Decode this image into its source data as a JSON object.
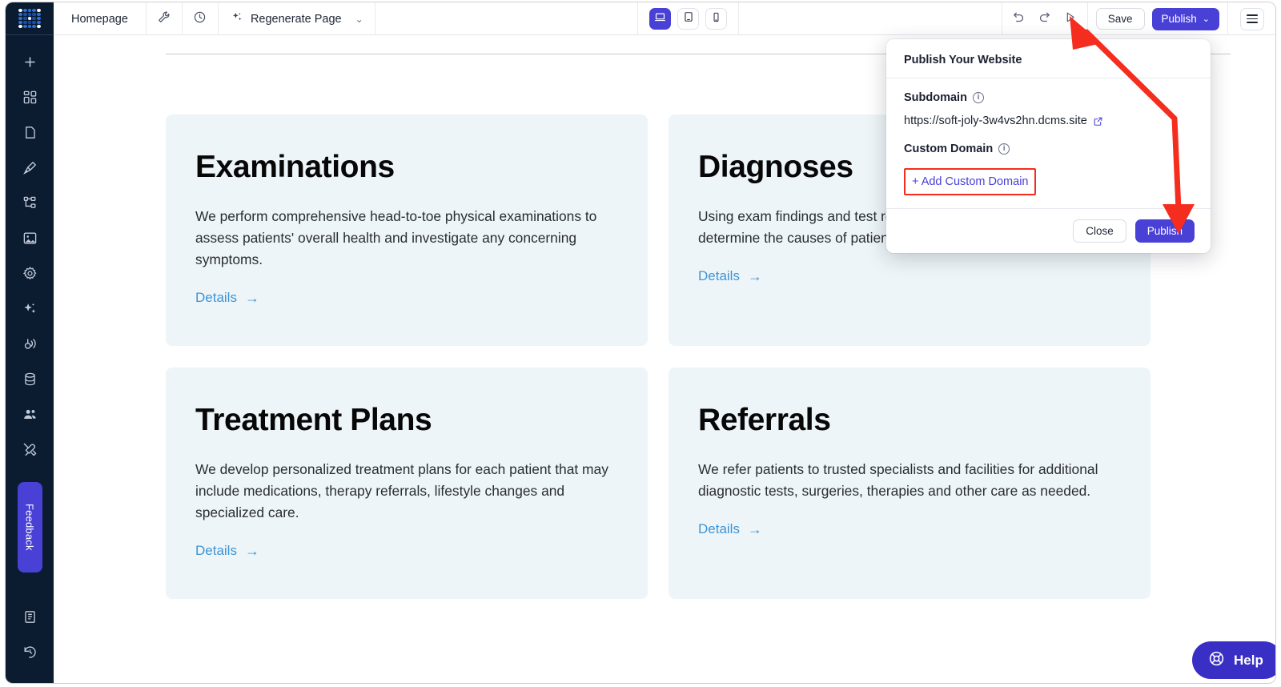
{
  "app": {
    "logo_icon": "dot-grid-logo-icon"
  },
  "toolbar": {
    "page_name": "Homepage",
    "wrench_icon": "wrench-icon",
    "history_icon": "clock-history-icon",
    "regenerate_label": "Regenerate Page",
    "regenerate_sparkle_icon": "sparkles-icon",
    "chevron": "⌄",
    "devices": [
      {
        "name": "desktop",
        "icon": "desktop-icon",
        "active": true
      },
      {
        "name": "tablet",
        "icon": "tablet-icon",
        "active": false
      },
      {
        "name": "mobile",
        "icon": "mobile-icon",
        "active": false
      }
    ],
    "undo_icon": "undo-icon",
    "redo_icon": "redo-icon",
    "preview_icon": "play-preview-icon",
    "save_label": "Save",
    "publish_label": "Publish",
    "publish_chevron": "⌄",
    "menu_icon": "hamburger-menu-icon"
  },
  "sidebar": {
    "items": [
      {
        "name": "add",
        "icon": "plus-icon"
      },
      {
        "name": "components",
        "icon": "grid-blocks-icon"
      },
      {
        "name": "pages",
        "icon": "page-icon"
      },
      {
        "name": "design",
        "icon": "paint-brush-icon"
      },
      {
        "name": "sitemap",
        "icon": "sitemap-icon"
      },
      {
        "name": "media",
        "icon": "image-icon"
      },
      {
        "name": "settings",
        "icon": "gear-icon"
      },
      {
        "name": "ai",
        "icon": "sparkles-icon"
      },
      {
        "name": "integrations",
        "icon": "broadcast-icon"
      },
      {
        "name": "database",
        "icon": "database-icon"
      },
      {
        "name": "team",
        "icon": "users-icon"
      },
      {
        "name": "tools",
        "icon": "tools-icon"
      }
    ],
    "feedback_label": "Feedback",
    "bottom_items": [
      {
        "name": "docs",
        "icon": "book-icon"
      },
      {
        "name": "version-history",
        "icon": "history-restore-icon"
      }
    ]
  },
  "canvas": {
    "cards": [
      {
        "title": "Examinations",
        "description": "We perform comprehensive head-to-toe physical examinations to assess patients' overall health and investigate any concerning symptoms.",
        "link_label": "Details",
        "link_arrow": "→"
      },
      {
        "title": "Diagnoses",
        "description": "Using exam findings and test results, we make diagnoses to determine the causes of patients' health issues.",
        "link_label": "Details",
        "link_arrow": "→"
      },
      {
        "title": "Treatment Plans",
        "description": "We develop personalized treatment plans for each patient that may include medications, therapy referrals, lifestyle changes and specialized care.",
        "link_label": "Details",
        "link_arrow": "→"
      },
      {
        "title": "Referrals",
        "description": "We refer patients to trusted specialists and facilities for additional diagnostic tests, surgeries, therapies and other care as needed.",
        "link_label": "Details",
        "link_arrow": "→"
      }
    ]
  },
  "publish_popup": {
    "title": "Publish Your Website",
    "subdomain_label": "Subdomain",
    "subdomain_info_icon": "info-icon",
    "subdomain_url": "https://soft-joly-3w4vs2hn.dcms.site",
    "external_link_icon": "external-link-icon",
    "custom_domain_label": "Custom Domain",
    "custom_domain_info_icon": "info-icon",
    "add_custom_domain_label": "+ Add Custom Domain",
    "close_label": "Close",
    "publish_label": "Publish"
  },
  "help": {
    "label": "Help",
    "icon": "lifebuoy-icon"
  },
  "colors": {
    "accent_purple": "#4940d6",
    "help_purple": "#3a2fc4",
    "sidebar_navy": "#0b1b30",
    "card_bg": "#eef5f8",
    "link_blue": "#3d94d6",
    "annotation_red": "#f42d1f"
  }
}
